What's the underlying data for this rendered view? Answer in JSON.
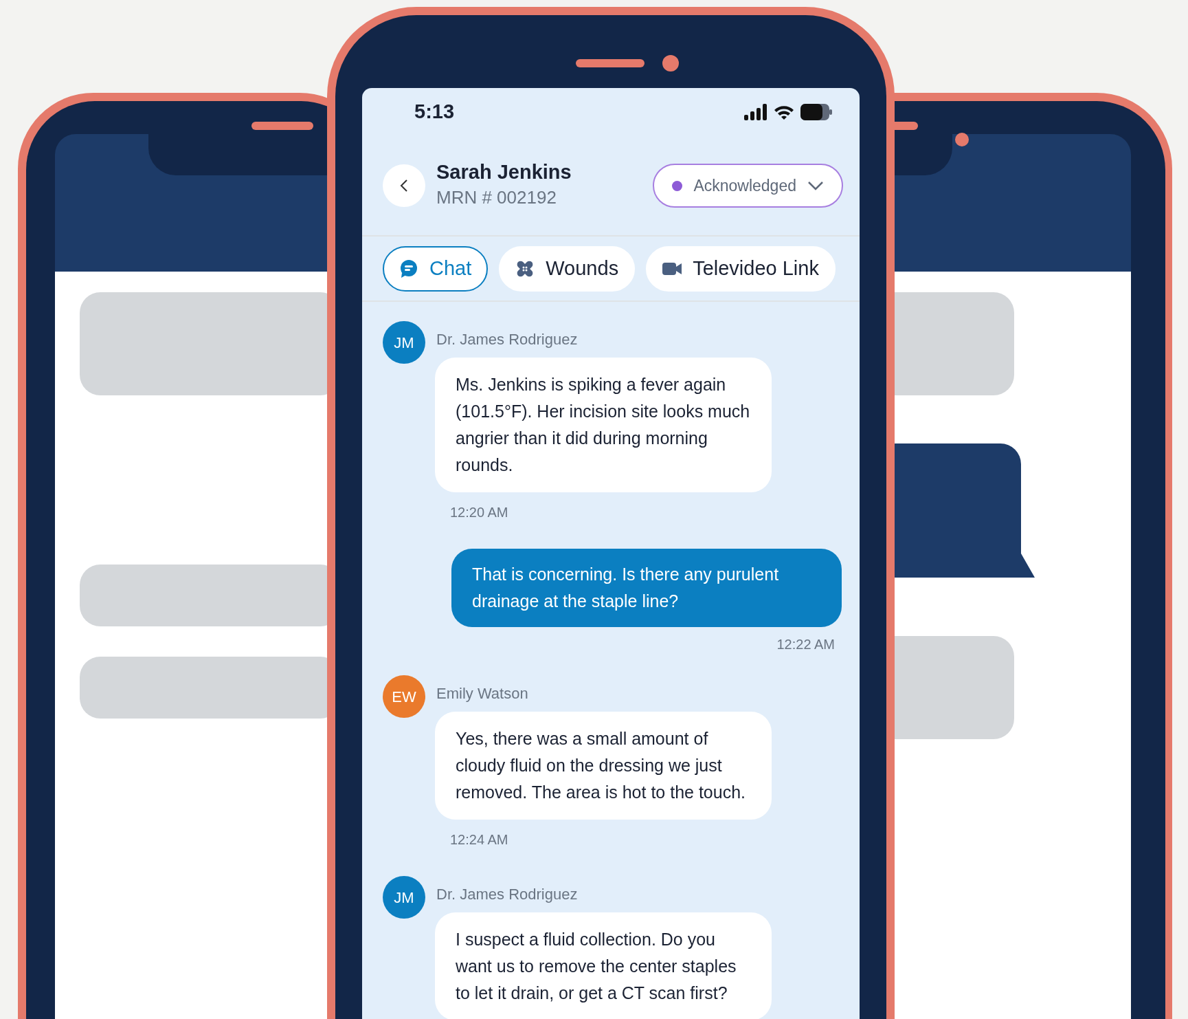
{
  "status_bar": {
    "time": "5:13"
  },
  "header": {
    "name": "Sarah Jenkins",
    "mrn": "MRN # 002192",
    "status": "Acknowledged"
  },
  "tabs": [
    {
      "label": "Chat",
      "kind": "chat",
      "selected": true
    },
    {
      "label": "Wounds",
      "kind": "wounds",
      "selected": false
    },
    {
      "label": "Televideo Link",
      "kind": "video",
      "selected": false
    }
  ],
  "messages": [
    {
      "kind": "incoming",
      "initials": "JM",
      "color": "#0b7fc1",
      "sender": "Dr. James Rodriguez",
      "text": "Ms. Jenkins is spiking a fever again (101.5°F). Her incision site looks much angrier than it did during morning rounds.",
      "time": "12:20 AM"
    },
    {
      "kind": "outgoing",
      "text": "That is concerning. Is there any purulent drainage at the staple line?",
      "time": "12:22 AM"
    },
    {
      "kind": "incoming",
      "initials": "EW",
      "color": "#ea7a2c",
      "sender": "Emily Watson",
      "text": "Yes, there was a small amount of cloudy fluid on the dressing we just removed. The area is hot to the touch.",
      "time": "12:24 AM"
    },
    {
      "kind": "incoming",
      "initials": "JM",
      "color": "#0b7fc1",
      "sender": "Dr. James Rodriguez",
      "text": "I suspect a fluid collection. Do you want us to remove the center staples to let it drain, or get a CT scan first?"
    }
  ]
}
